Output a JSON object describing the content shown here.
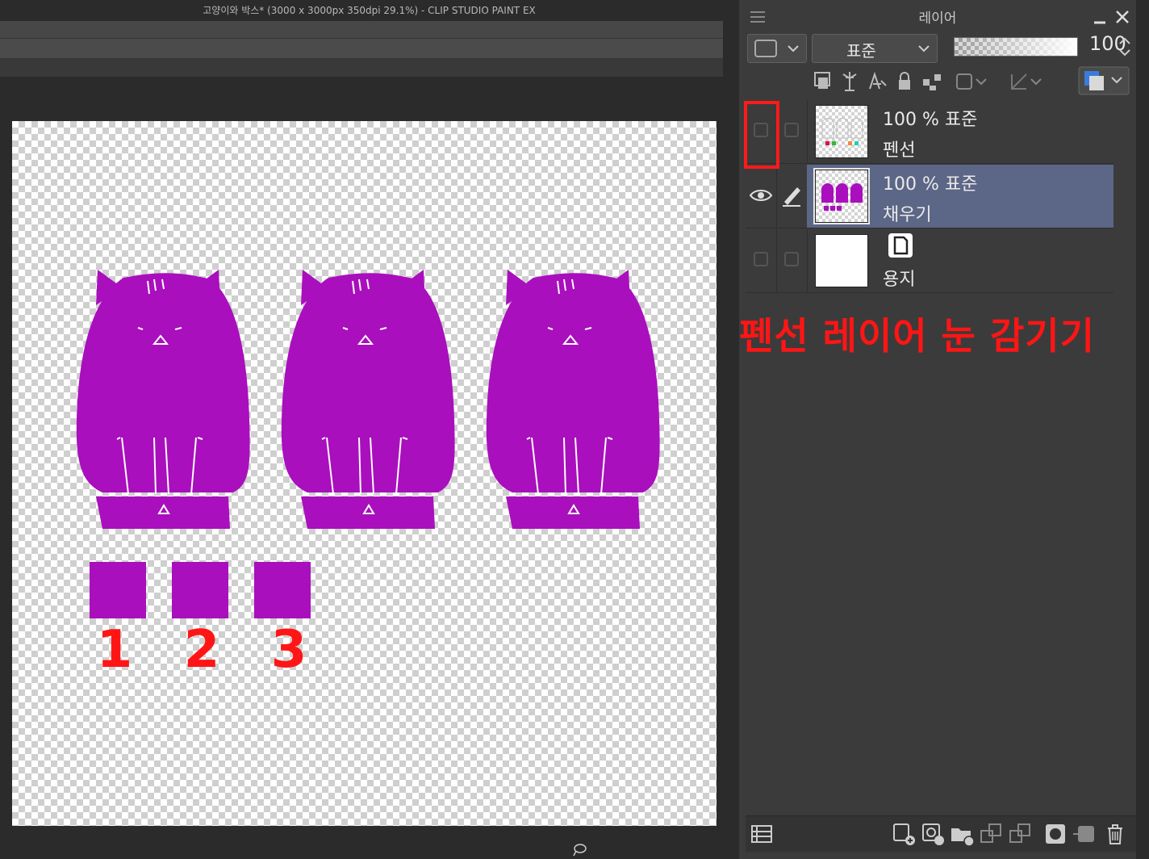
{
  "window": {
    "title": "고양이와 박스* (3000 x 3000px 350dpi 29.1%)  - CLIP STUDIO PAINT EX"
  },
  "canvas": {
    "shape_color": "#a90fbd",
    "labels": [
      "1",
      "2",
      "3"
    ],
    "label_color": "#ff1515"
  },
  "layer_panel": {
    "title": "레이어",
    "blend_mode": "표준",
    "opacity": "100",
    "layers": [
      {
        "mode": "100 % 표준",
        "name": "펜선",
        "visible": false,
        "selected": false
      },
      {
        "mode": "100 % 표준",
        "name": "채우기",
        "visible": true,
        "selected": true
      },
      {
        "mode": "",
        "name": "용지",
        "visible": false,
        "selected": false
      }
    ],
    "annotation": "펜선 레이어 눈 감기기"
  }
}
